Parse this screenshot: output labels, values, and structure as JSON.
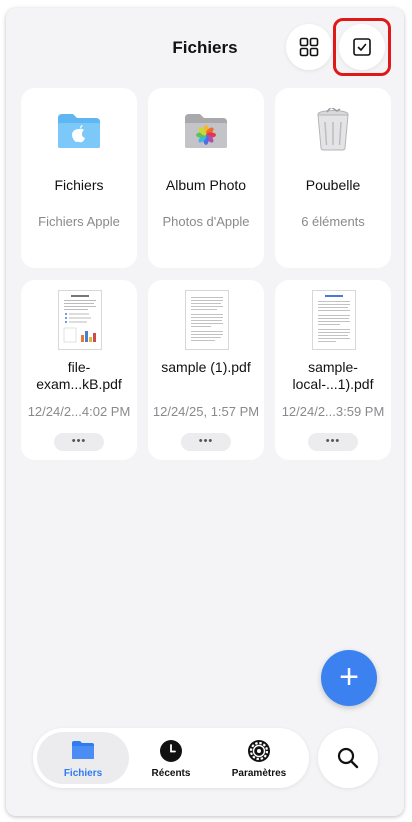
{
  "header": {
    "title": "Fichiers"
  },
  "colors": {
    "accent": "#2f7bf0",
    "fab": "#3b82f0",
    "highlight": "#e01818"
  },
  "toolbar": {
    "view_icon": "grid-icon",
    "select_icon": "checkbox-icon"
  },
  "locations": [
    {
      "name": "Fichiers",
      "sub": "Fichiers Apple",
      "icon": "folder-apple-icon"
    },
    {
      "name": "Album Photo",
      "sub": "Photos d'Apple",
      "icon": "folder-photos-icon"
    },
    {
      "name": "Poubelle",
      "sub": "6 éléments",
      "icon": "trash-icon"
    }
  ],
  "files": [
    {
      "name": "file-exam...kB.pdf",
      "date": "12/24/2...4:02 PM",
      "more": "•••"
    },
    {
      "name": "sample (1).pdf",
      "date": "12/24/25, 1:57 PM",
      "more": "•••"
    },
    {
      "name": "sample-local-...1).pdf",
      "date": "12/24/2...3:59 PM",
      "more": "•••"
    }
  ],
  "fab": {
    "label": "+"
  },
  "tabs": [
    {
      "label": "Fichiers",
      "icon": "folder-icon",
      "active": true
    },
    {
      "label": "Récents",
      "icon": "clock-icon",
      "active": false
    },
    {
      "label": "Paramètres",
      "icon": "gear-icon",
      "active": false
    }
  ],
  "search": {
    "icon": "search-icon"
  }
}
